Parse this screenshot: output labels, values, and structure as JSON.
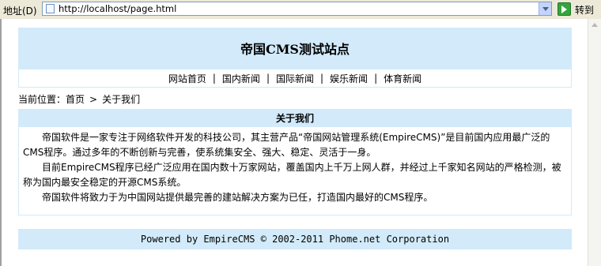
{
  "browser": {
    "address_label": "地址(D)",
    "url": "http://localhost/page.html",
    "go_label": "转到"
  },
  "site": {
    "title": "帝国CMS测试站点"
  },
  "nav": {
    "items": [
      "网站首页",
      "国内新闻",
      "国际新闻",
      "娱乐新闻",
      "体育新闻"
    ],
    "separator": "|"
  },
  "breadcrumb": {
    "prefix": "当前位置：",
    "home": "首页",
    "arrow": ">",
    "current": "关于我们"
  },
  "article": {
    "title": "关于我们",
    "paragraphs": [
      "帝国软件是一家专注于网络软件开发的科技公司，其主营产品“帝国网站管理系统(EmpireCMS)”是目前国内应用最广泛的CMS程序。通过多年的不断创新与完善，使系统集安全、强大、稳定、灵活于一身。",
      "目前EmpireCMS程序已经广泛应用在国内数十万家网站，覆盖国内上千万上网人群，并经过上千家知名网站的严格检测，被称为国内最安全稳定的开源CMS系统。",
      "帝国软件将致力于为中国网站提供最完善的建站解决方案为已任，打造国内最好的CMS程序。"
    ]
  },
  "footer": {
    "text": "Powered by EmpireCMS © 2002-2011 Phome.net Corporation"
  },
  "colors": {
    "panel_bg": "#d2eafa",
    "toolbar_bg": "#ece9d8"
  }
}
